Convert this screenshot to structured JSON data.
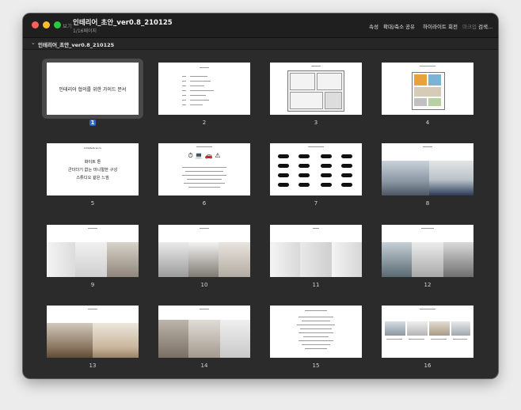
{
  "toolbar": {
    "sidebar_button": "보기",
    "doc_title": "인테리어_초안_ver0.8_210125",
    "doc_subtitle": "1/16페이지",
    "tools": [
      "속성",
      "확대/축소",
      "공유",
      "하이라이트",
      "회전",
      "마크업",
      "검색..."
    ]
  },
  "group": {
    "label": "인테리어_초안_ver0.8_210125"
  },
  "pages": {
    "selected": 1,
    "numbers": [
      "1",
      "2",
      "3",
      "4",
      "5",
      "6",
      "7",
      "8",
      "9",
      "10",
      "11",
      "12",
      "13",
      "14",
      "15",
      "16"
    ],
    "cover_title": "인테리어 협의를 위한 가이드 문서",
    "p5_heading": "Art&Reference",
    "p5_lines": [
      "화이트 톤",
      "군더더기 없는 미니멀한 구성",
      "스튜디오 같은 느낌"
    ]
  },
  "colors": {
    "window_bg": "#2b2b2b",
    "selection": "#2f64d7",
    "close": "#fe5f57",
    "minimize": "#febc2e",
    "zoom": "#28c840"
  }
}
